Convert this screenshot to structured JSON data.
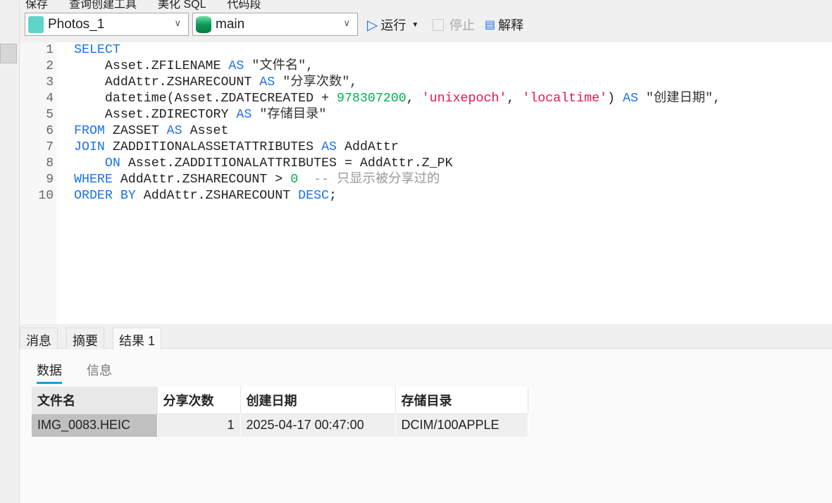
{
  "top_toolbar": {
    "items": [
      "保存",
      "查询创建工具",
      "美化 SQL",
      "代码段"
    ]
  },
  "toolbar": {
    "connection": "Photos_1",
    "database": "main",
    "run": "运行",
    "stop": "停止",
    "explain": "解释"
  },
  "editor": {
    "line_numbers": [
      "1",
      "2",
      "3",
      "4",
      "5",
      "6",
      "7",
      "8",
      "9",
      "10"
    ],
    "lines": [
      [
        [
          "kw",
          "SELECT"
        ]
      ],
      [
        [
          "t",
          "    Asset.ZFILENAME "
        ],
        [
          "kw",
          "AS"
        ],
        [
          "cjk",
          " \"文件名\","
        ]
      ],
      [
        [
          "t",
          "    AddAttr.ZSHARECOUNT "
        ],
        [
          "kw",
          "AS"
        ],
        [
          "cjk",
          " \"分享次数\","
        ]
      ],
      [
        [
          "t",
          "    datetime(Asset.ZDATECREATED + "
        ],
        [
          "num",
          "978307200"
        ],
        [
          "t",
          ", "
        ],
        [
          "str",
          "'unixepoch'"
        ],
        [
          "t",
          ", "
        ],
        [
          "str",
          "'localtime'"
        ],
        [
          "t",
          ") "
        ],
        [
          "kw",
          "AS"
        ],
        [
          "cjk",
          " \"创建日期\","
        ]
      ],
      [
        [
          "t",
          "    Asset.ZDIRECTORY "
        ],
        [
          "kw",
          "AS"
        ],
        [
          "cjk",
          " \"存储目录\""
        ]
      ],
      [
        [
          "kw",
          "FROM"
        ],
        [
          "t",
          " ZASSET "
        ],
        [
          "kw",
          "AS"
        ],
        [
          "t",
          " Asset"
        ]
      ],
      [
        [
          "kw",
          "JOIN"
        ],
        [
          "t",
          " ZADDITIONALASSETATTRIBUTES "
        ],
        [
          "kw",
          "AS"
        ],
        [
          "t",
          " AddAttr"
        ]
      ],
      [
        [
          "t",
          "    "
        ],
        [
          "kw",
          "ON"
        ],
        [
          "t",
          " Asset.ZADDITIONALATTRIBUTES = AddAttr.Z_PK"
        ]
      ],
      [
        [
          "kw",
          "WHERE"
        ],
        [
          "t",
          " AddAttr.ZSHARECOUNT > "
        ],
        [
          "num",
          "0"
        ],
        [
          "cmt",
          "  -- 只显示被分享过的"
        ]
      ],
      [
        [
          "kw",
          "ORDER BY"
        ],
        [
          "t",
          " AddAttr.ZSHARECOUNT "
        ],
        [
          "kw",
          "DESC"
        ],
        [
          "t",
          ";"
        ]
      ]
    ]
  },
  "results": {
    "tabs": [
      "消息",
      "摘要",
      "结果 1"
    ],
    "active_tab": "结果 1",
    "subtabs": [
      "数据",
      "信息"
    ],
    "active_subtab": "数据",
    "columns": [
      "文件名",
      "分享次数",
      "创建日期",
      "存储目录"
    ],
    "rows": [
      [
        "IMG_0083.HEIC",
        "1",
        "2025-04-17 00:47:00",
        "DCIM/100APPLE"
      ]
    ]
  },
  "colors": {
    "keyword": "#1a73e8",
    "number": "#00b050",
    "string": "#e8174f",
    "accent": "#1a9be0"
  }
}
